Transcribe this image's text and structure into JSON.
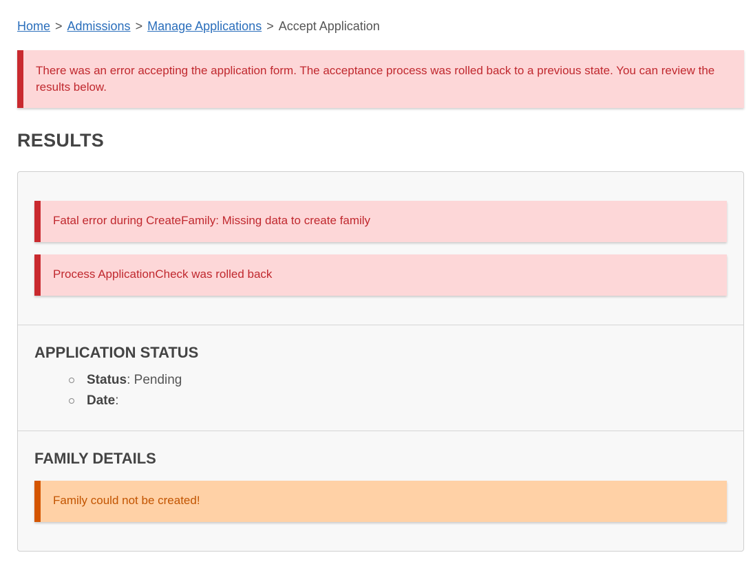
{
  "breadcrumb": {
    "items": [
      "Home",
      "Admissions",
      "Manage Applications"
    ],
    "current": "Accept Application",
    "separator": ">"
  },
  "top_alert": {
    "message": "There was an error accepting the application form. The acceptance process was rolled back to a previous state. You can review the results below."
  },
  "results": {
    "title": "RESULTS",
    "errors": [
      "Fatal error during CreateFamily: Missing data to create family",
      "Process ApplicationCheck was rolled back"
    ],
    "application_status": {
      "title": "APPLICATION STATUS",
      "status_label": "Status",
      "status_value": "Pending",
      "date_label": "Date",
      "date_value": ""
    },
    "family_details": {
      "title": "FAMILY DETAILS",
      "warning": "Family could not be created!"
    }
  },
  "colors": {
    "error_bg": "#fdd7d8",
    "error_border": "#c92a2f",
    "error_text": "#c0282e",
    "warning_bg": "#ffd1a6",
    "warning_border": "#d45500",
    "warning_text": "#c25400",
    "link": "#2a6ebb"
  }
}
